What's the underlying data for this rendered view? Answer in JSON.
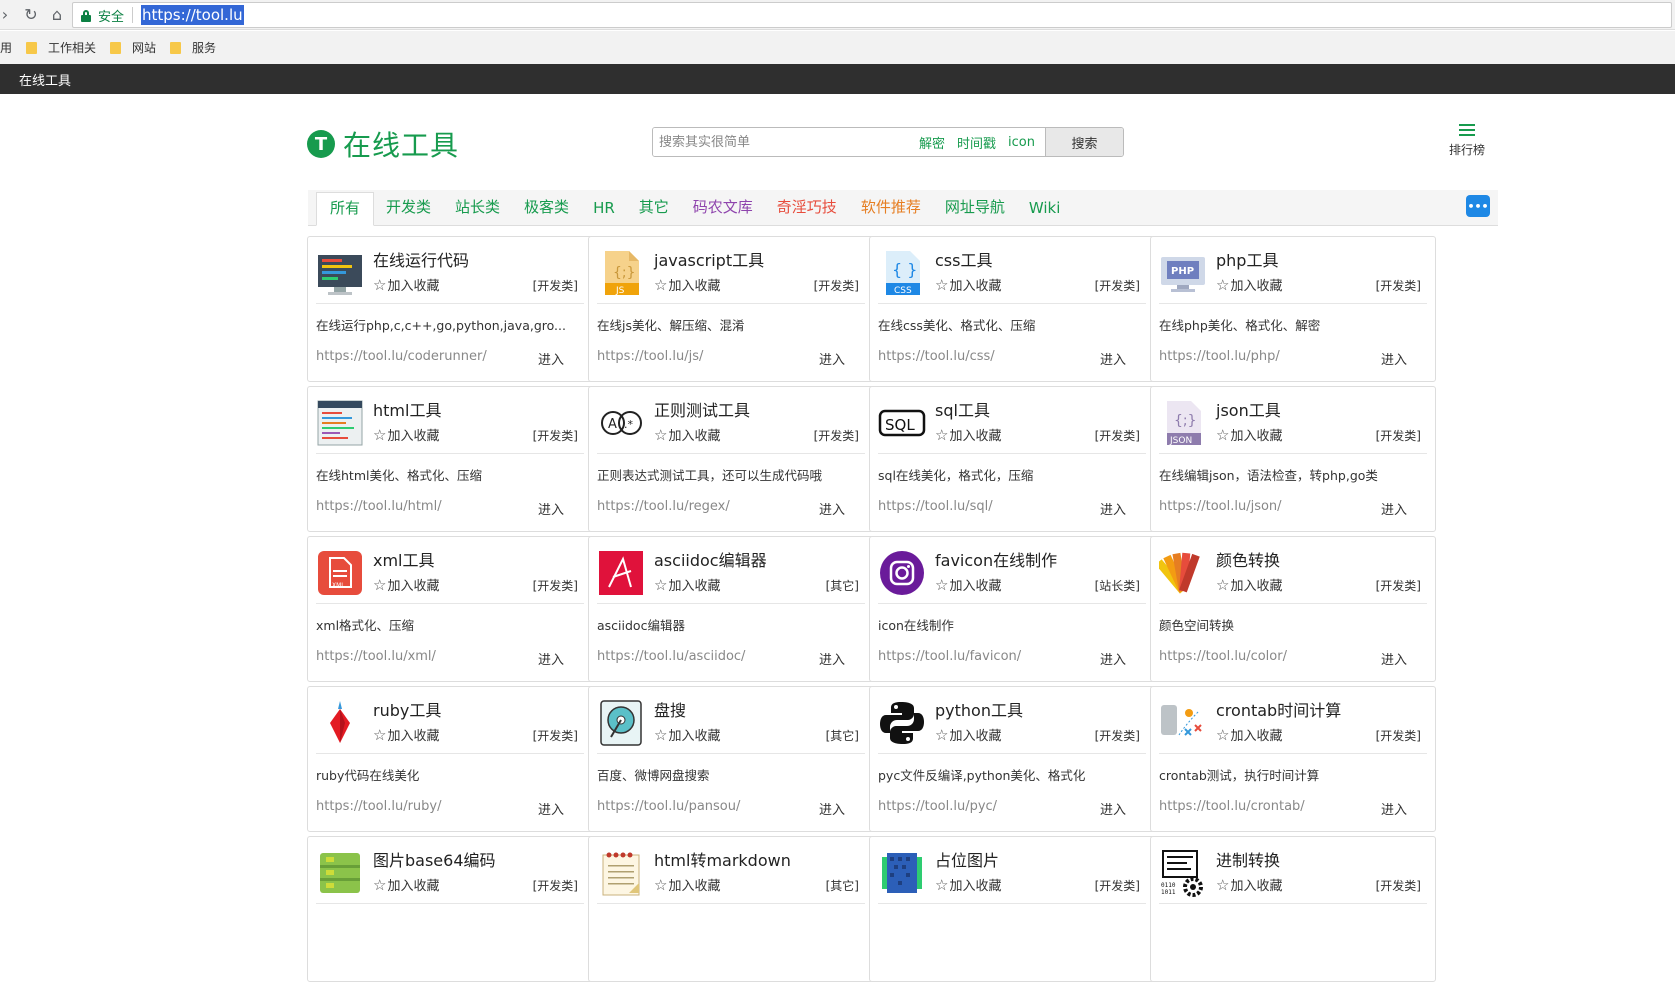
{
  "browser": {
    "url": "https://tool.lu",
    "secure_label": "安全",
    "bookmarks_prefix": "用",
    "bookmarks": [
      "工作相关",
      "网站",
      "服务"
    ]
  },
  "sitebar": {
    "title": "在线工具"
  },
  "header": {
    "logo_letter": "T",
    "logo_text": "在线工具",
    "search_placeholder": "搜索其实很简单",
    "quick_links": [
      "解密",
      "时间戳",
      "icon"
    ],
    "search_button": "搜索",
    "rank_label": "排行榜"
  },
  "tabs": [
    {
      "label": "所有",
      "color": "#179b4e"
    },
    {
      "label": "开发类",
      "color": "#179b4e"
    },
    {
      "label": "站长类",
      "color": "#179b4e"
    },
    {
      "label": "极客类",
      "color": "#179b4e"
    },
    {
      "label": "HR",
      "color": "#179b4e"
    },
    {
      "label": "其它",
      "color": "#179b4e"
    },
    {
      "label": "码农文库",
      "color": "#8e44ad"
    },
    {
      "label": "奇淫巧技",
      "color": "#e74c3c"
    },
    {
      "label": "软件推荐",
      "color": "#e67e22"
    },
    {
      "label": "网址导航",
      "color": "#179b4e"
    },
    {
      "label": "Wiki",
      "color": "#179b4e"
    }
  ],
  "card_common": {
    "fav_label": "加入收藏",
    "enter_label": "进入"
  },
  "cards": [
    {
      "title": "在线运行代码",
      "category": "[开发类]",
      "desc": "在线运行php,c,c++,go,python,java,gro...",
      "url": "https://tool.lu/coderunner/",
      "icon": "code-runner-icon"
    },
    {
      "title": "javascript工具",
      "category": "[开发类]",
      "desc": "在线js美化、解压缩、混淆",
      "url": "https://tool.lu/js/",
      "icon": "js-file-icon"
    },
    {
      "title": "css工具",
      "category": "[开发类]",
      "desc": "在线css美化、格式化、压缩",
      "url": "https://tool.lu/css/",
      "icon": "css-file-icon"
    },
    {
      "title": "php工具",
      "category": "[开发类]",
      "desc": "在线php美化、格式化、解密",
      "url": "https://tool.lu/php/",
      "icon": "php-monitor-icon"
    },
    {
      "title": "html工具",
      "category": "[开发类]",
      "desc": "在线html美化、格式化、压缩",
      "url": "https://tool.lu/html/",
      "icon": "html-editor-icon"
    },
    {
      "title": "正则测试工具",
      "category": "[开发类]",
      "desc": "正则表达式测试工具，还可以生成代码哦",
      "url": "https://tool.lu/regex/",
      "icon": "regex-icon"
    },
    {
      "title": "sql工具",
      "category": "[开发类]",
      "desc": "sql在线美化，格式化，压缩",
      "url": "https://tool.lu/sql/",
      "icon": "sql-icon"
    },
    {
      "title": "json工具",
      "category": "[开发类]",
      "desc": "在线编辑json，语法检查，转php,go类",
      "url": "https://tool.lu/json/",
      "icon": "json-file-icon"
    },
    {
      "title": "xml工具",
      "category": "[开发类]",
      "desc": "xml格式化、压缩",
      "url": "https://tool.lu/xml/",
      "icon": "xml-file-icon"
    },
    {
      "title": "asciidoc编辑器",
      "category": "[其它]",
      "desc": "asciidoc编辑器",
      "url": "https://tool.lu/asciidoc/",
      "icon": "asciidoc-icon"
    },
    {
      "title": "favicon在线制作",
      "category": "[站长类]",
      "desc": "icon在线制作",
      "url": "https://tool.lu/favicon/",
      "icon": "instagram-icon"
    },
    {
      "title": "颜色转换",
      "category": "[开发类]",
      "desc": "颜色空间转换",
      "url": "https://tool.lu/color/",
      "icon": "color-swatch-icon"
    },
    {
      "title": "ruby工具",
      "category": "[开发类]",
      "desc": "ruby代码在线美化",
      "url": "https://tool.lu/ruby/",
      "icon": "ruby-gem-icon"
    },
    {
      "title": "盘搜",
      "category": "[其它]",
      "desc": "百度、微博网盘搜索",
      "url": "https://tool.lu/pansou/",
      "icon": "hard-disk-icon"
    },
    {
      "title": "python工具",
      "category": "[开发类]",
      "desc": "pyc文件反编译,python美化、格式化",
      "url": "https://tool.lu/pyc/",
      "icon": "python-icon"
    },
    {
      "title": "crontab时间计算",
      "category": "[开发类]",
      "desc": "crontab测试，执行时间计算",
      "url": "https://tool.lu/crontab/",
      "icon": "crontab-icon"
    },
    {
      "title": "图片base64编码",
      "category": "[开发类]",
      "desc": "",
      "url": "",
      "icon": "base64-image-icon"
    },
    {
      "title": "html转markdown",
      "category": "[其它]",
      "desc": "",
      "url": "",
      "icon": "notepad-icon"
    },
    {
      "title": "占位图片",
      "category": "[开发类]",
      "desc": "",
      "url": "",
      "icon": "placeholder-image-icon"
    },
    {
      "title": "进制转换",
      "category": "[开发类]",
      "desc": "",
      "url": "",
      "icon": "binary-gear-icon"
    }
  ]
}
